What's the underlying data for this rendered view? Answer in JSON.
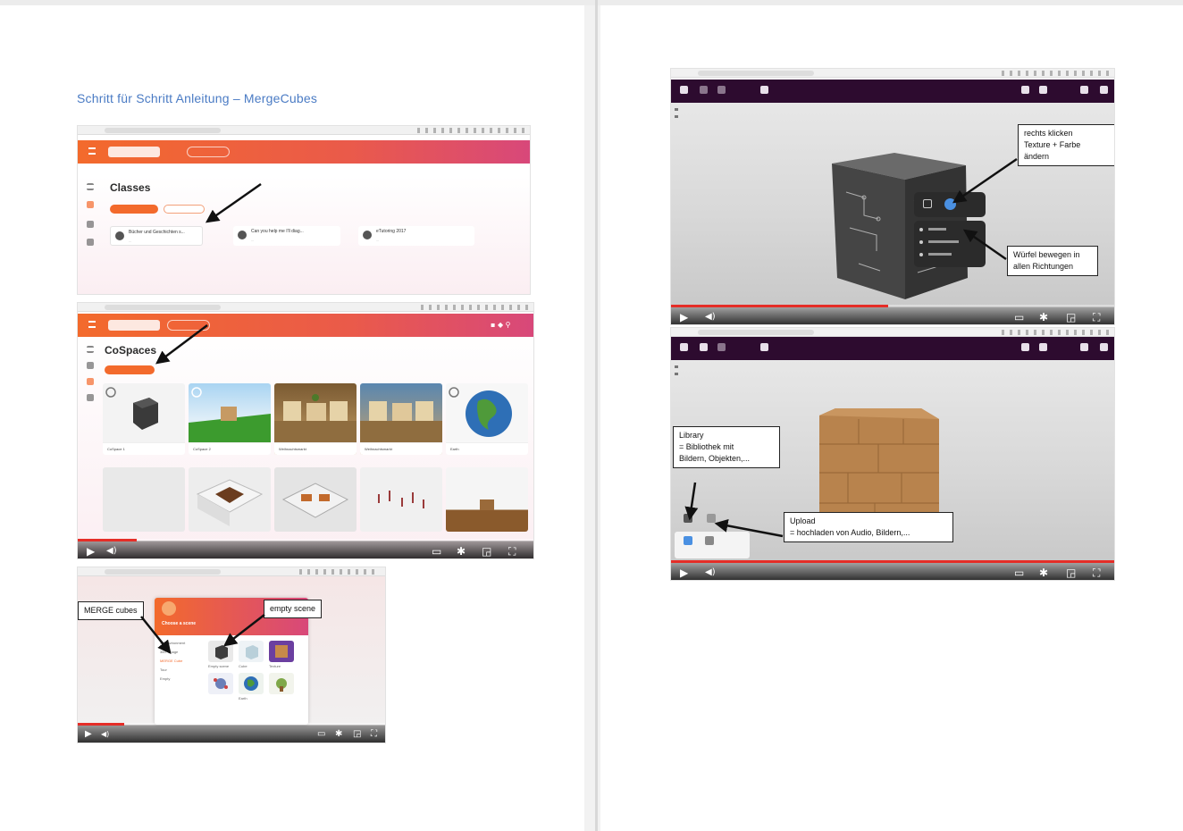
{
  "document": {
    "title": "Schritt für Schritt Anleitung – MergeCubes"
  },
  "shot1": {
    "heading": "Classes",
    "tabs": [
      "",
      ""
    ],
    "cards": [
      {
        "name": "Bücher und Geschichten s...",
        "sub": "..."
      },
      {
        "name": "Can you help me I'll diag...",
        "sub": "..."
      },
      {
        "name": "eTutoring 2017",
        "sub": "..."
      }
    ]
  },
  "shot2": {
    "heading": "CoSpaces",
    "thumbs": [
      {
        "caption": "CoSpace 1",
        "kind": "cube-dark"
      },
      {
        "caption": "CoSpace 2",
        "kind": "green-box"
      },
      {
        "caption": "Weihnachtsmarkt",
        "kind": "scene"
      },
      {
        "caption": "Weihnachtsmarkt",
        "kind": "scene"
      },
      {
        "caption": "Earth",
        "kind": "globe"
      },
      {
        "caption": "",
        "kind": "blank"
      },
      {
        "caption": "",
        "kind": "room"
      },
      {
        "caption": "",
        "kind": "room2"
      },
      {
        "caption": "",
        "kind": "figures"
      },
      {
        "caption": "",
        "kind": "wall"
      }
    ]
  },
  "shot3": {
    "dialog_title": "Choose a scene",
    "menu_items": [
      "3D environment",
      "360° image",
      "MERGE Cube",
      "Tour",
      "Empty"
    ],
    "scenes": [
      "Empty scene",
      "Cube",
      "Texture"
    ],
    "scenes2": [
      "",
      "Earth",
      ""
    ]
  },
  "callouts": {
    "merge_cubes": "MERGE cubes",
    "empty_scene": "empty scene",
    "right_click_line1": "rechts klicken",
    "right_click_line2": "Texture + Farbe",
    "right_click_line3": "ändern",
    "move_line1": "Würfel bewegen in",
    "move_line2": "allen Richtungen",
    "library_line1": "Library",
    "library_line2": "= Bibliothek mit",
    "library_line3": "Bildern, Objekten,...",
    "upload_line1": "Upload",
    "upload_line2": "= hochladen von Audio, Bildern,..."
  },
  "video": {
    "time1": "",
    "time2": ""
  },
  "colors": {
    "title_blue": "#4a7bc4",
    "cospaces_orange": "#f36a2c",
    "editor_purple": "#2d0b2f",
    "progress_red": "#e52d27"
  }
}
